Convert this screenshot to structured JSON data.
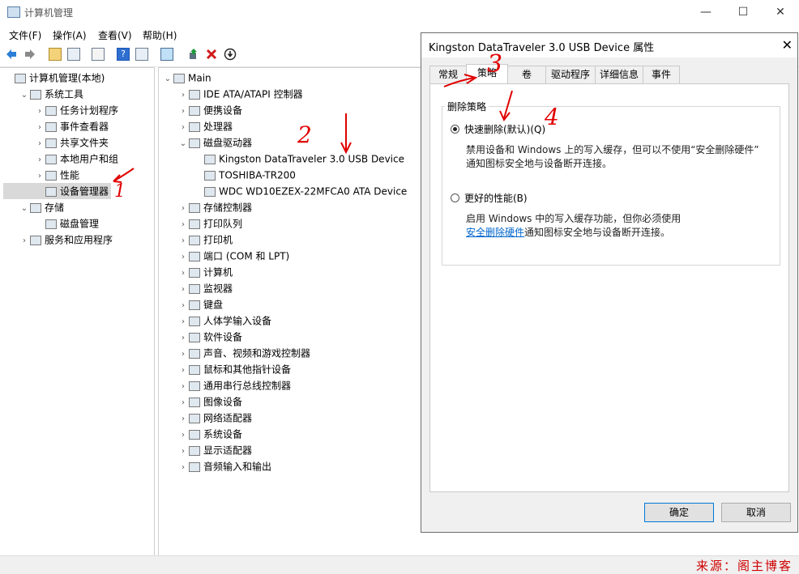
{
  "window": {
    "title": "计算机管理",
    "minimize": "—",
    "maximize": "☐",
    "close": "✕"
  },
  "menu": [
    "文件(F)",
    "操作(A)",
    "查看(V)",
    "帮助(H)"
  ],
  "left_tree": [
    {
      "label": "计算机管理(本地)",
      "indent": 0,
      "exp": ""
    },
    {
      "label": "系统工具",
      "indent": 1,
      "exp": "⌄"
    },
    {
      "label": "任务计划程序",
      "indent": 2,
      "exp": "›"
    },
    {
      "label": "事件查看器",
      "indent": 2,
      "exp": "›"
    },
    {
      "label": "共享文件夹",
      "indent": 2,
      "exp": "›"
    },
    {
      "label": "本地用户和组",
      "indent": 2,
      "exp": "›"
    },
    {
      "label": "性能",
      "indent": 2,
      "exp": "›"
    },
    {
      "label": "设备管理器",
      "indent": 2,
      "exp": "",
      "selected": true
    },
    {
      "label": "存储",
      "indent": 1,
      "exp": "⌄"
    },
    {
      "label": "磁盘管理",
      "indent": 2,
      "exp": ""
    },
    {
      "label": "服务和应用程序",
      "indent": 1,
      "exp": "›"
    }
  ],
  "device_tree": [
    {
      "label": "Main",
      "indent": 0,
      "exp": "⌄"
    },
    {
      "label": "IDE ATA/ATAPI 控制器",
      "indent": 1,
      "exp": "›"
    },
    {
      "label": "便携设备",
      "indent": 1,
      "exp": "›"
    },
    {
      "label": "处理器",
      "indent": 1,
      "exp": "›"
    },
    {
      "label": "磁盘驱动器",
      "indent": 1,
      "exp": "⌄"
    },
    {
      "label": "Kingston DataTraveler 3.0 USB Device",
      "indent": 2,
      "exp": ""
    },
    {
      "label": "TOSHIBA-TR200",
      "indent": 2,
      "exp": ""
    },
    {
      "label": "WDC WD10EZEX-22MFCA0 ATA Device",
      "indent": 2,
      "exp": ""
    },
    {
      "label": "存储控制器",
      "indent": 1,
      "exp": "›"
    },
    {
      "label": "打印队列",
      "indent": 1,
      "exp": "›"
    },
    {
      "label": "打印机",
      "indent": 1,
      "exp": "›"
    },
    {
      "label": "端口 (COM 和 LPT)",
      "indent": 1,
      "exp": "›"
    },
    {
      "label": "计算机",
      "indent": 1,
      "exp": "›"
    },
    {
      "label": "监视器",
      "indent": 1,
      "exp": "›"
    },
    {
      "label": "键盘",
      "indent": 1,
      "exp": "›"
    },
    {
      "label": "人体学输入设备",
      "indent": 1,
      "exp": "›"
    },
    {
      "label": "软件设备",
      "indent": 1,
      "exp": "›"
    },
    {
      "label": "声音、视频和游戏控制器",
      "indent": 1,
      "exp": "›"
    },
    {
      "label": "鼠标和其他指针设备",
      "indent": 1,
      "exp": "›"
    },
    {
      "label": "通用串行总线控制器",
      "indent": 1,
      "exp": "›"
    },
    {
      "label": "图像设备",
      "indent": 1,
      "exp": "›"
    },
    {
      "label": "网络适配器",
      "indent": 1,
      "exp": "›"
    },
    {
      "label": "系统设备",
      "indent": 1,
      "exp": "›"
    },
    {
      "label": "显示适配器",
      "indent": 1,
      "exp": "›"
    },
    {
      "label": "音频输入和输出",
      "indent": 1,
      "exp": "›"
    }
  ],
  "dialog": {
    "title": "Kingston DataTraveler 3.0 USB Device 属性",
    "close": "✕",
    "tabs": [
      "常规",
      "策略",
      "卷",
      "驱动程序",
      "详细信息",
      "事件"
    ],
    "active_tab": "策略",
    "group_title": "删除策略",
    "option1_label": "快速删除(默认)(Q)",
    "option1_desc_line1": "禁用设备和 Windows 上的写入缓存，但可以不使用“安全删除硬件”",
    "option1_desc_line2": "通知图标安全地与设备断开连接。",
    "option2_label": "更好的性能(B)",
    "option2_desc_line1": "启用 Windows 中的写入缓存功能，但你必须使用",
    "option2_link": "安全删除硬件",
    "option2_desc_line2_rest": "通知图标安全地与设备断开连接。",
    "ok": "确定",
    "cancel": "取消"
  },
  "annotations": [
    "1",
    "2",
    "3",
    "4"
  ],
  "watermark": "来源：阁主博客",
  "colors": {
    "annotation": "#e00000",
    "link": "#0066cc",
    "selection": "#d9d9d9"
  }
}
